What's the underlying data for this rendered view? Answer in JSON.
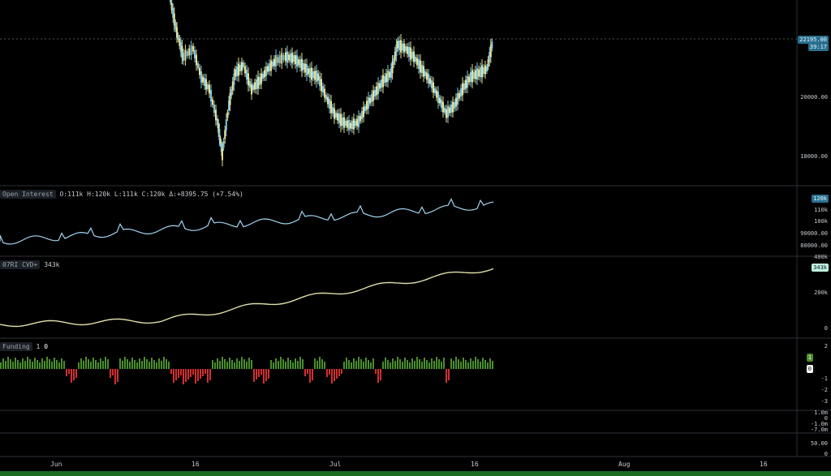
{
  "colors": {
    "background": "#000000",
    "candle_up": "#7fc4e8",
    "candle_down": "#e8e08a",
    "oi_line": "#9fd3ef",
    "cvd_line": "#e0dfa8",
    "funding_pos": "#4a8f2a",
    "funding_neg": "#d32f2f",
    "separator": "#2c3038"
  },
  "price_pane": {
    "axis_labels": [
      "20000.00",
      "18000.00"
    ],
    "last_price": "22195.00",
    "countdown": "39:17"
  },
  "oi_pane": {
    "title": "Open Interest",
    "ohlc": "O:111k H:120k L:111k C:120k Δ:+8395.75 (+7.54%)",
    "last_value": "120k",
    "axis_labels": [
      "110k",
      "100k",
      "90000.00",
      "80000.00"
    ]
  },
  "cvd_pane": {
    "title": "07RI CVD+",
    "value": "343k",
    "last_value": "343k",
    "axis_labels": [
      "400k",
      "200k",
      "0"
    ]
  },
  "funding_pane": {
    "title": "Funding",
    "v1": "1",
    "v2": "0",
    "tag_green": "1",
    "tag_white": "0",
    "axis_labels": [
      "2",
      "-1",
      "-2",
      "-3"
    ]
  },
  "lower_pane": {
    "axis_labels": [
      "1.0m",
      "0",
      "-1.0m",
      "-7.0m"
    ]
  },
  "bottom_pane": {
    "axis_labels": [
      "50.00",
      "0"
    ]
  },
  "time_axis": [
    "Jun",
    "16",
    "Jul",
    "16",
    "Aug",
    "16"
  ]
}
